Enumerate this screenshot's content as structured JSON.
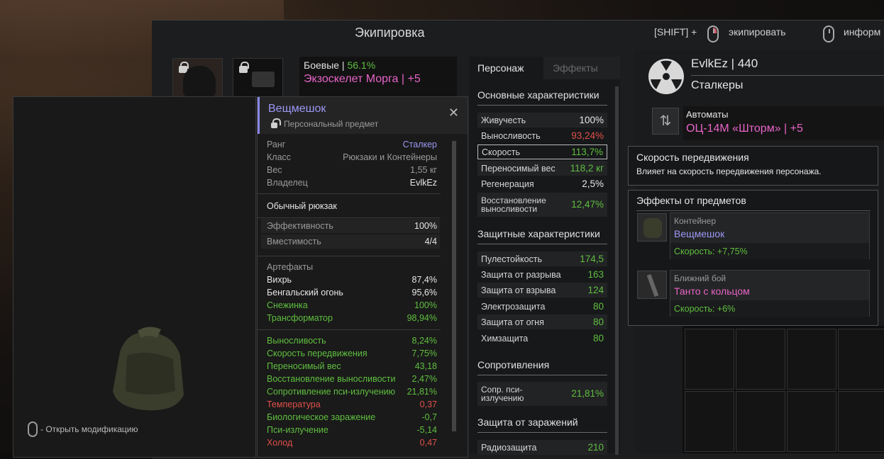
{
  "window": {
    "title": "Экипировка"
  },
  "hints": {
    "shift": "[SHIFT] +",
    "equip": "экипировать",
    "info": "информ"
  },
  "equip_slot": {
    "category": "Боевые |",
    "percent": "56.1%",
    "name": "Экзоскелет Морга | +5"
  },
  "item_card": {
    "name": "Вещмешок",
    "subtitle": "Персональный предмет",
    "info": [
      {
        "label": "Ранг",
        "value": "Сталкер"
      },
      {
        "label": "Класс",
        "value": "Рюкзаки и Контейнеры"
      },
      {
        "label": "Вес",
        "value": "1,55 кг"
      },
      {
        "label": "Владелец",
        "value": "EvlkEz"
      }
    ],
    "description": "Обычный рюкзак",
    "stats": [
      {
        "label": "Эффективность",
        "value": "100%"
      },
      {
        "label": "Вместимость",
        "value": "4/4"
      }
    ],
    "artifacts_title": "Артефакты",
    "artifacts": [
      {
        "label": "Вихрь",
        "value": "87,4%"
      },
      {
        "label": "Бенгальский огонь",
        "value": "95,6%"
      },
      {
        "label": "Снежинка",
        "value": "100%"
      },
      {
        "label": "Трансформатор",
        "value": "98,94%"
      }
    ],
    "effects": [
      {
        "label": "Выносливость",
        "value": "8,24%"
      },
      {
        "label": "Скорость передвижения",
        "value": "7,75%"
      },
      {
        "label": "Переносимый вес",
        "value": "43,18"
      },
      {
        "label": "Восстановление выносливости",
        "value": "2,47%"
      },
      {
        "label": "Сопротивление пси-излучению",
        "value": "21,81%"
      },
      {
        "label": "Температура",
        "value": "0,37"
      },
      {
        "label": "Биологическое заражение",
        "value": "-0,7"
      },
      {
        "label": "Пси-излучение",
        "value": "-5,14"
      },
      {
        "label": "Холод",
        "value": "0,47"
      }
    ]
  },
  "left_hint": "- Открыть модификацию",
  "tabs": {
    "character": "Персонаж",
    "effects": "Эффекты"
  },
  "main_stats": {
    "title": "Основные характеристики",
    "rows": [
      {
        "label": "Живучесть",
        "value": "100%"
      },
      {
        "label": "Выносливость",
        "value": "93,24%"
      },
      {
        "label": "Скорость",
        "value": "113,7%"
      },
      {
        "label": "Переносимый вес",
        "value": "118,2 кг"
      },
      {
        "label": "Регенерация",
        "value": "2,5%"
      },
      {
        "label": "Восстановление выносливости",
        "value": "12,47%"
      }
    ]
  },
  "protect_stats": {
    "title": "Защитные характеристики",
    "rows": [
      {
        "label": "Пулестойкость",
        "value": "174,5"
      },
      {
        "label": "Защита от разрыва",
        "value": "163"
      },
      {
        "label": "Защита от взрыва",
        "value": "124"
      },
      {
        "label": "Электрозащита",
        "value": "80"
      },
      {
        "label": "Защита от огня",
        "value": "80"
      },
      {
        "label": "Химзащита",
        "value": "80"
      }
    ]
  },
  "resist": {
    "title": "Сопротивления",
    "rows": [
      {
        "label": "Сопр. пси-излучению",
        "value": "21,81%"
      }
    ]
  },
  "contam": {
    "title": "Защита от заражений",
    "rows": [
      {
        "label": "Радиозащита",
        "value": "210"
      }
    ]
  },
  "player": {
    "name": "EvlkEz | 440",
    "faction": "Сталкеры"
  },
  "weapon": {
    "category": "Автоматы",
    "name": "ОЦ-14М «Шторм» | +5"
  },
  "tooltip": {
    "title": "Скорость передвижения",
    "text": "Влияет на скорость передвижения персонажа."
  },
  "item_effects": {
    "title": "Эффекты от предметов",
    "items": [
      {
        "type": "Контейнер",
        "name": "Вещмешок",
        "effect": "Скорость: +7,75%"
      },
      {
        "type": "Ближний бой",
        "name": "Танто с кольцом",
        "effect": "Скорость: +6%"
      }
    ]
  }
}
